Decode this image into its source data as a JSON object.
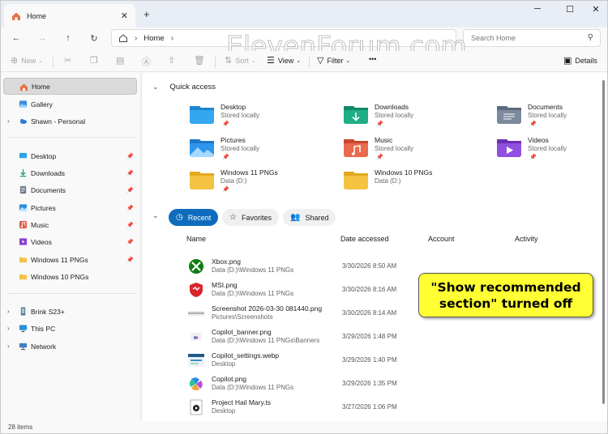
{
  "window": {
    "tab_title": "Home",
    "minimize": "─",
    "maximize": "☐",
    "close": "✕"
  },
  "address": {
    "crumb": "Home",
    "search_placeholder": "Search Home"
  },
  "watermark": "ElevenForum.com",
  "toolbar": {
    "new": "New",
    "sort": "Sort",
    "view": "View",
    "filter": "Filter",
    "more": "•••",
    "details": "Details"
  },
  "sidebar": {
    "items": [
      {
        "label": "Home",
        "selected": true
      },
      {
        "label": "Gallery"
      },
      {
        "label": "Shawn - Personal"
      },
      {
        "label": "Desktop",
        "pinned": true
      },
      {
        "label": "Downloads",
        "pinned": true
      },
      {
        "label": "Documents",
        "pinned": true
      },
      {
        "label": "Pictures",
        "pinned": true
      },
      {
        "label": "Music",
        "pinned": true
      },
      {
        "label": "Videos",
        "pinned": true
      },
      {
        "label": "Windows 11 PNGs",
        "pinned": true
      },
      {
        "label": "Windows 10 PNGs"
      },
      {
        "label": "Brink S23+"
      },
      {
        "label": "This PC"
      },
      {
        "label": "Network"
      }
    ]
  },
  "quick_access": {
    "title": "Quick access",
    "items": [
      {
        "name": "Desktop",
        "sub": "Stored locally"
      },
      {
        "name": "Downloads",
        "sub": "Stored locally"
      },
      {
        "name": "Documents",
        "sub": "Stored locally"
      },
      {
        "name": "Pictures",
        "sub": "Stored locally"
      },
      {
        "name": "Music",
        "sub": "Stored locally"
      },
      {
        "name": "Videos",
        "sub": "Stored locally"
      },
      {
        "name": "Windows 11 PNGs",
        "sub": "Data (D:)"
      },
      {
        "name": "Windows 10 PNGs",
        "sub": "Data (D:)"
      }
    ]
  },
  "tabs": {
    "recent": "Recent",
    "favorites": "Favorites",
    "shared": "Shared"
  },
  "columns": {
    "name": "Name",
    "date": "Date accessed",
    "account": "Account",
    "activity": "Activity"
  },
  "files": [
    {
      "name": "Xbox.png",
      "path": "Data (D:)\\Windows 11 PNGs",
      "date": "3/30/2026 8:50 AM"
    },
    {
      "name": "MSI.png",
      "path": "Data (D:)\\Windows 11 PNGs",
      "date": "3/30/2026 8:16 AM"
    },
    {
      "name": "Screenshot 2026-03-30 081440.png",
      "path": "Pictures\\Screenshots",
      "date": "3/30/2026 8:14 AM"
    },
    {
      "name": "Copilot_banner.png",
      "path": "Data (D:)\\Windows 11 PNGs\\Banners",
      "date": "3/29/2026 1:48 PM"
    },
    {
      "name": "Copilot_settings.webp",
      "path": "Desktop",
      "date": "3/29/2026 1:40 PM"
    },
    {
      "name": "Copilot.png",
      "path": "Data (D:)\\Windows 11 PNGs",
      "date": "3/29/2026 1:35 PM"
    },
    {
      "name": "Project Hail Mary.ts",
      "path": "Desktop",
      "date": "3/27/2026 1:06 PM"
    }
  ],
  "callout": {
    "line1": "\"Show recommended",
    "line2": "section\" turned off"
  },
  "status": {
    "count": "28 items"
  },
  "colors": {
    "accent": "#0f6cbd",
    "callout": "#ffff33",
    "folder": "#f5c342"
  }
}
